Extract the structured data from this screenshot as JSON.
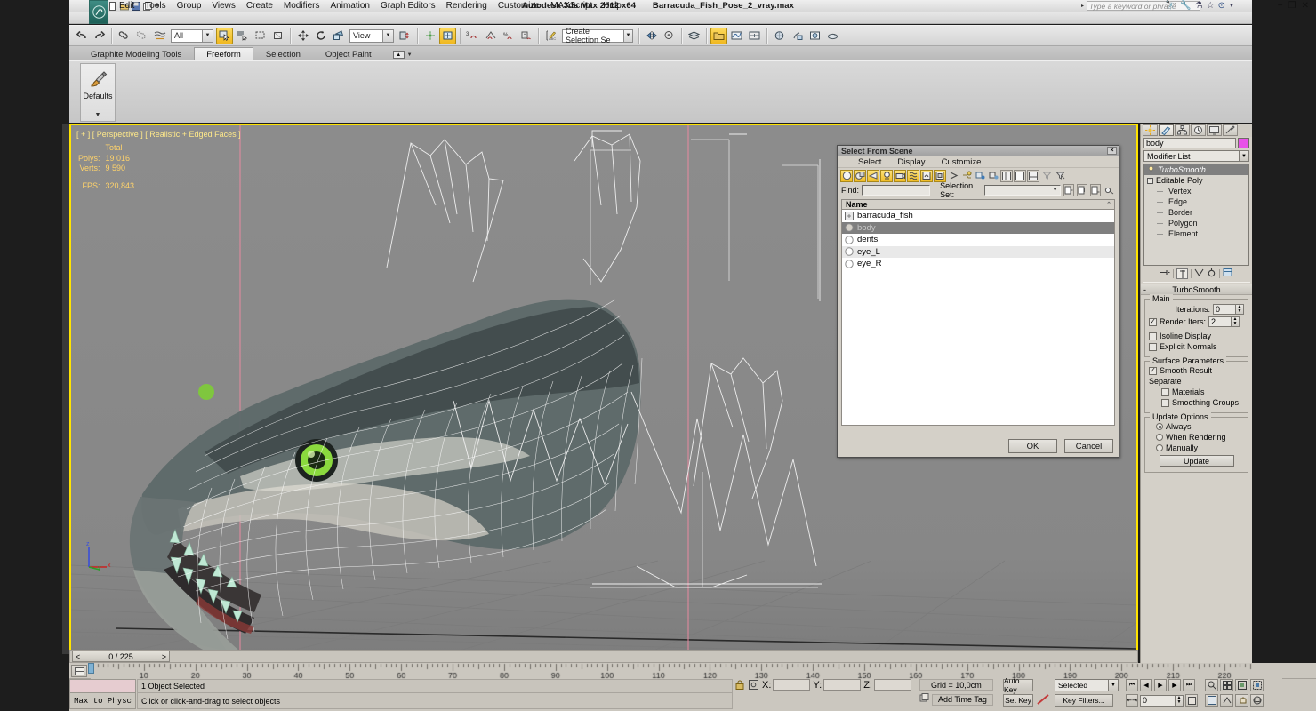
{
  "titlebar": {
    "app_title": "Autodesk 3ds Max  2012 x64",
    "file_name": "Barracuda_Fish_Pose_2_vray.max",
    "search_placeholder": "Type a keyword or phrase",
    "qat": [
      "new-file-icon",
      "open-file-icon",
      "save-file-icon",
      "save-as-icon",
      "qat-dropdown-icon"
    ],
    "help_icons": [
      "binoculars-icon",
      "wrench-icon",
      "subscription-icon",
      "favorites-star-icon",
      "help-icon"
    ],
    "window_buttons": [
      "minimize",
      "restore",
      "close"
    ]
  },
  "menubar": {
    "items": [
      "Edit",
      "Tools",
      "Group",
      "Views",
      "Create",
      "Modifiers",
      "Animation",
      "Graph Editors",
      "Rendering",
      "Customize",
      "MAXScript",
      "Help"
    ]
  },
  "main_toolbar": {
    "selection_filter": "All",
    "reference_coord": "View",
    "named_selection_set": "Create Selection Se",
    "snap_value": "3",
    "buttons": [
      "undo-icon",
      "redo-icon",
      "select-and-link-icon",
      "unlink-selection-icon",
      "bind-to-space-warp-icon",
      "select-object-icon",
      "select-by-name-icon",
      "rectangular-selection-region-icon",
      "window-crossing-icon",
      "select-and-move-icon",
      "select-and-rotate-icon",
      "select-and-scale-icon",
      "use-center-flyout-icon",
      "select-and-manipulate-icon",
      "snaps-toggle-icon",
      "angle-snap-icon",
      "percent-snap-icon",
      "spinner-snap-icon",
      "edit-named-selection-icon",
      "mirror-icon",
      "align-icon",
      "layer-manager-icon",
      "graphite-modeling-toolbar-icon",
      "curve-editor-icon",
      "schematic-view-icon",
      "material-editor-icon",
      "render-setup-icon",
      "rendered-frame-window-icon",
      "render-production-icon"
    ]
  },
  "ribbon": {
    "tabs": [
      "Graphite Modeling Tools",
      "Freeform",
      "Selection",
      "Object Paint"
    ],
    "active_tab": "Freeform",
    "panel": {
      "label": "Defaults",
      "icon": "paintbrush-icon"
    }
  },
  "viewport": {
    "label": "[ + ] [ Perspective ] [ Realistic + Edged Faces ]",
    "stats": {
      "column_header": "Total",
      "rows": [
        {
          "key": "Polys:",
          "value": "19 016"
        },
        {
          "key": "Verts:",
          "value": "9 590"
        }
      ],
      "fps_key": "FPS:",
      "fps_value": "320,843"
    },
    "axis": {
      "z": "z",
      "y": "y",
      "x": "x"
    },
    "model_name": "barracuda_fish"
  },
  "dialog": {
    "title": "Select From Scene",
    "close_label": "×",
    "menu": [
      "Select",
      "Display",
      "Customize"
    ],
    "toolbar_icons": [
      "display-all-icon",
      "display-geometry-icon",
      "display-shapes-icon",
      "display-lights-icon",
      "display-cameras-icon",
      "display-helpers-icon",
      "display-space-warps-icon",
      "display-groups-icon",
      "display-xrefs-icon",
      "display-bone-objects-icon",
      "display-children-icon",
      "display-influences-icon",
      "expand-all-icon",
      "collapse-all-icon",
      "select-subtree-icon",
      "filter-icon",
      "advanced-filter-icon"
    ],
    "find_label": "Find:",
    "find_value": "",
    "selection_set_label": "Selection Set:",
    "selection_set_value": "",
    "list_header": "Name",
    "items": [
      {
        "name": "barracuda_fish",
        "icon": "group-icon",
        "selected": false
      },
      {
        "name": "body",
        "icon": "geometry-icon",
        "selected": true
      },
      {
        "name": "dents",
        "icon": "geometry-icon",
        "selected": false
      },
      {
        "name": "eye_L",
        "icon": "geometry-icon",
        "selected": false
      },
      {
        "name": "eye_R",
        "icon": "geometry-icon",
        "selected": false
      }
    ],
    "ok_label": "OK",
    "cancel_label": "Cancel"
  },
  "command_panel": {
    "tabs": [
      "create-tab-icon",
      "modify-tab-icon",
      "hierarchy-tab-icon",
      "motion-tab-icon",
      "display-tab-icon",
      "utilities-tab-icon"
    ],
    "active_tab_index": 1,
    "object_name": "body",
    "object_color": "#e852e8",
    "modifier_list_label": "Modifier List",
    "stack": [
      {
        "label": "TurboSmooth",
        "selected": true,
        "type": "modifier"
      },
      {
        "label": "Editable Poly",
        "selected": false,
        "type": "base"
      },
      {
        "label": "Vertex",
        "selected": false,
        "type": "sub"
      },
      {
        "label": "Edge",
        "selected": false,
        "type": "sub"
      },
      {
        "label": "Border",
        "selected": false,
        "type": "sub"
      },
      {
        "label": "Polygon",
        "selected": false,
        "type": "sub"
      },
      {
        "label": "Element",
        "selected": false,
        "type": "sub"
      }
    ],
    "stack_tools": [
      "pin-stack-icon",
      "show-end-result-icon",
      "make-unique-icon",
      "remove-modifier-icon",
      "configure-modifier-sets-icon"
    ],
    "rollout": {
      "title": "TurboSmooth",
      "collapse_glyph": "-",
      "main_group": {
        "title": "Main",
        "iterations_label": "Iterations:",
        "iterations_value": "0",
        "render_iters_label": "Render Iters:",
        "render_iters_value": "2",
        "render_iters_checked": true,
        "isoline_display_label": "Isoline Display",
        "isoline_display_checked": false,
        "explicit_normals_label": "Explicit Normals",
        "explicit_normals_checked": false
      },
      "surface_group": {
        "title": "Surface Parameters",
        "smooth_result_label": "Smooth Result",
        "smooth_result_checked": true,
        "separate_label": "Separate",
        "materials_label": "Materials",
        "materials_checked": false,
        "smoothing_groups_label": "Smoothing Groups",
        "smoothing_groups_checked": false
      },
      "update_group": {
        "title": "Update Options",
        "options": [
          {
            "label": "Always",
            "selected": true
          },
          {
            "label": "When Rendering",
            "selected": false
          },
          {
            "label": "Manually",
            "selected": false
          }
        ],
        "update_button": "Update"
      }
    }
  },
  "time_slider": {
    "prev_label": "<",
    "next_label": ">",
    "frame_text": "0 / 225",
    "ruler_ticks": [
      "10",
      "20",
      "30",
      "40",
      "50",
      "60",
      "70",
      "80",
      "90",
      "100",
      "110",
      "120",
      "130",
      "140",
      "150",
      "160",
      "170",
      "180",
      "190",
      "200",
      "210",
      "220"
    ],
    "ruler_start": 0,
    "ruler_end": 225
  },
  "status_bar": {
    "max_to_physc": "Max to Physc",
    "selection_status": "1 Object Selected",
    "prompt": "Click or click-and-drag to select objects",
    "lock_icon": "lock-selection-icon",
    "abs_rel_icon": "absolute-relative-transform-icon",
    "coord_labels": [
      "X:",
      "Y:",
      "Z:"
    ],
    "coord_values": [
      "",
      "",
      ""
    ],
    "grid_text": "Grid = 10,0cm",
    "add_time_tag": "Add Time Tag",
    "auto_key": "Auto Key",
    "set_key": "Set Key",
    "key_mode": "Selected",
    "key_filters": "Key Filters...",
    "current_frame": "0",
    "playback_buttons": [
      "go-to-start-icon",
      "previous-frame-icon",
      "play-animation-icon",
      "next-frame-icon",
      "go-to-end-icon"
    ],
    "nav_buttons": [
      "zoom-icon",
      "zoom-all-icon",
      "zoom-extents-icon",
      "zoom-region-icon",
      "pan-view-icon",
      "orbit-icon",
      "maximize-viewport-icon",
      "field-of-view-icon"
    ]
  }
}
